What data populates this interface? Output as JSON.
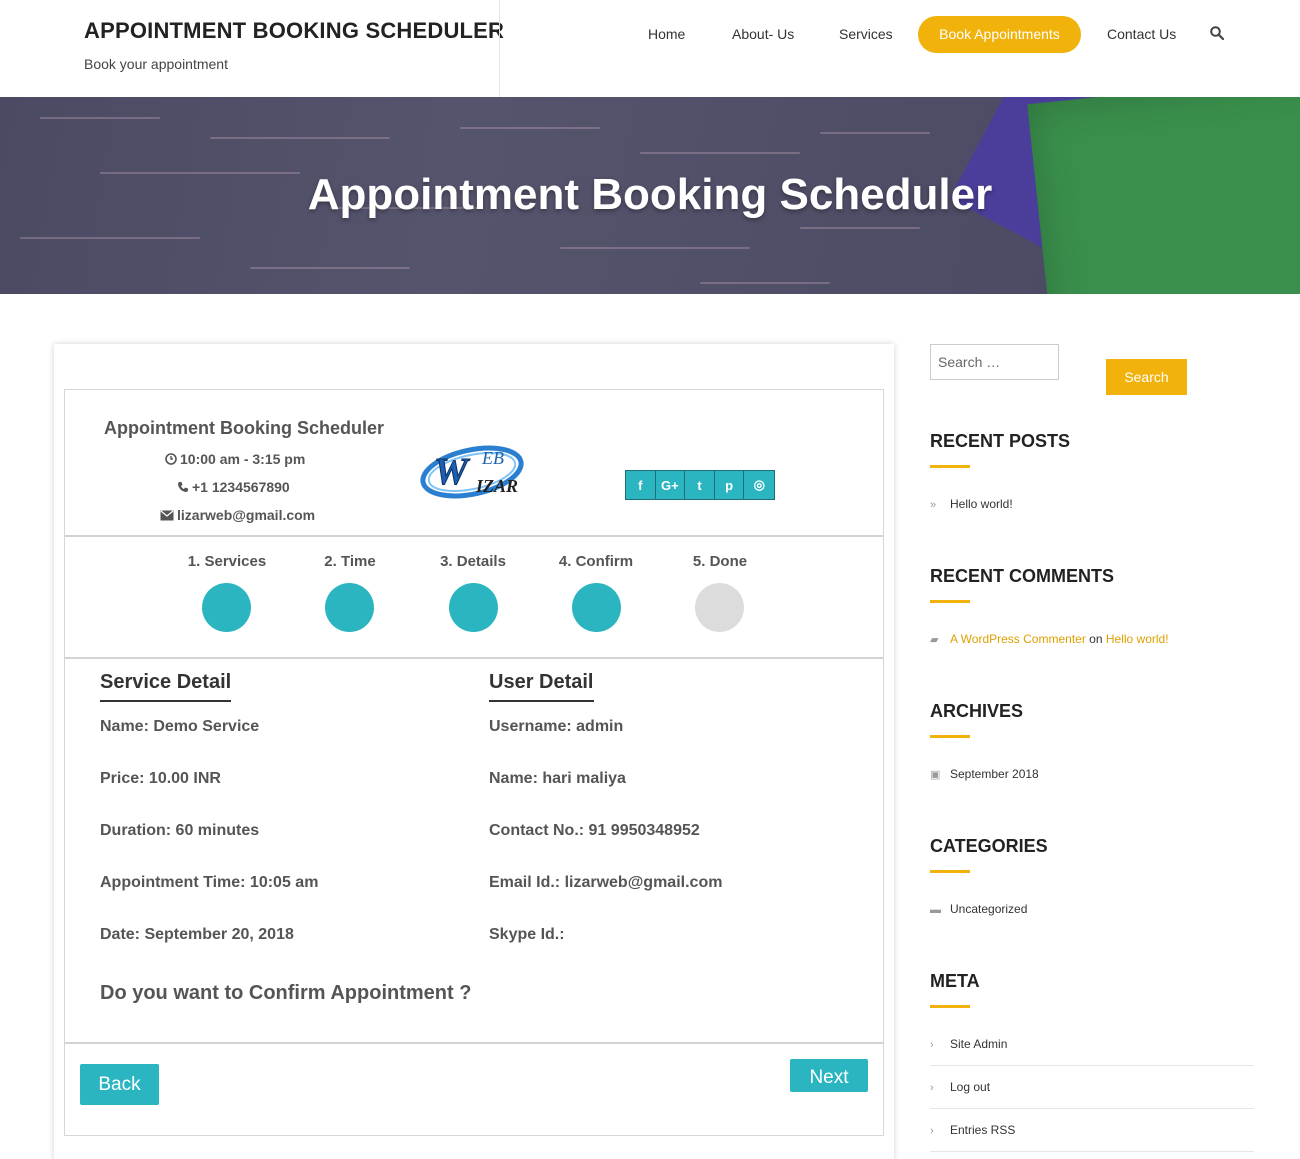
{
  "header": {
    "site_title": "APPOINTMENT BOOKING SCHEDULER",
    "tagline": "Book your appointment",
    "nav": [
      {
        "label": "Home"
      },
      {
        "label": "About- Us"
      },
      {
        "label": "Services"
      },
      {
        "label": "Book Appointments"
      },
      {
        "label": "Contact Us"
      }
    ],
    "search_icon": "search-icon"
  },
  "banner": {
    "title": "Appointment Booking Scheduler"
  },
  "booking": {
    "company_name": "Appointment Booking Scheduler",
    "hours": "10:00 am - 3:15 pm",
    "phone": "+1 1234567890",
    "email": "lizarweb@gmail.com",
    "logo_text": {
      "top": "EB",
      "bottom": "IZAR"
    },
    "social": [
      {
        "icon": "facebook-icon",
        "glyph": "f"
      },
      {
        "icon": "google-plus-icon",
        "glyph": "G+"
      },
      {
        "icon": "twitter-icon",
        "glyph": "t"
      },
      {
        "icon": "pinterest-icon",
        "glyph": "p"
      },
      {
        "icon": "instagram-icon",
        "glyph": "◎"
      }
    ],
    "steps": [
      {
        "label": "1. Services",
        "done": true
      },
      {
        "label": "2. Time",
        "done": true
      },
      {
        "label": "3. Details",
        "done": true
      },
      {
        "label": "4. Confirm",
        "done": true
      },
      {
        "label": "5. Done",
        "done": false
      }
    ],
    "service_detail": {
      "title": "Service Detail",
      "name": "Name:  Demo Service",
      "price": "Price:  10.00 INR",
      "duration": "Duration:  60 minutes",
      "time": "Appointment Time:  10:05 am",
      "date": "Date:  September 20, 2018"
    },
    "user_detail": {
      "title": "User Detail",
      "username": "Username:  admin",
      "name": "Name:  hari maliya",
      "contact": "Contact No.:  91 9950348952",
      "email": "Email Id.:  lizarweb@gmail.com",
      "skype": "Skype Id.:"
    },
    "confirm_question": "Do you want to Confirm Appointment ?",
    "back_label": "Back",
    "next_label": "Next"
  },
  "sidebar": {
    "search_placeholder": "Search …",
    "search_button": "Search",
    "recent_posts": {
      "title": "RECENT POSTS",
      "items": [
        "Hello world!"
      ]
    },
    "recent_comments": {
      "title": "RECENT COMMENTS",
      "author": "A WordPress Commenter",
      "on": "on",
      "post": "Hello world!"
    },
    "archives": {
      "title": "ARCHIVES",
      "items": [
        "September 2018"
      ]
    },
    "categories": {
      "title": "CATEGORIES",
      "items": [
        "Uncategorized"
      ]
    },
    "meta": {
      "title": "META",
      "items": [
        "Site Admin",
        "Log out",
        "Entries RSS"
      ]
    }
  },
  "colors": {
    "accent": "#f0b20b",
    "teal": "#2bb5c0",
    "pending": "#dcdcdc"
  }
}
